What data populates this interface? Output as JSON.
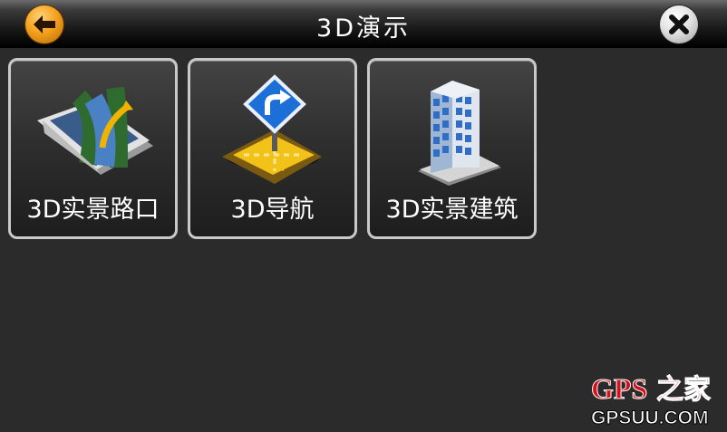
{
  "header": {
    "title": "3D演示"
  },
  "icons": {
    "back": "back-arrow-icon",
    "close": "close-x-icon"
  },
  "menu": {
    "items": [
      {
        "label": "3D实景路口",
        "icon": "junction-map-icon"
      },
      {
        "label": "3D导航",
        "icon": "turn-sign-crossroad-icon"
      },
      {
        "label": "3D实景建筑",
        "icon": "building-icon"
      }
    ]
  },
  "watermark": {
    "text_latin": "GPS",
    "text_cn": "之家",
    "url": "GPSUU.COM"
  },
  "colors": {
    "accent": "#f5a21e",
    "background": "#2b2b2b",
    "watermark_red": "#d4101a"
  }
}
